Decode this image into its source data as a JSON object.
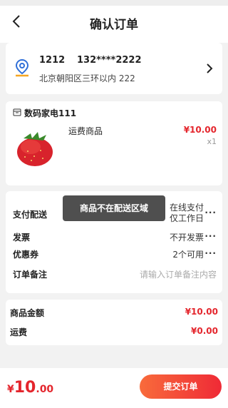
{
  "header": {
    "title": "确认订单",
    "back_icon": "chevron-left-icon"
  },
  "address": {
    "name": "1212",
    "phone": "132****2222",
    "detail": "北京朝阳区三环以内 222",
    "pin_icon": "location-pin-icon",
    "accent_color": "#2f6fd8",
    "arrow_icon": "chevron-right-icon"
  },
  "store": {
    "shop_icon": "shop-icon",
    "name": "数码家电111",
    "goods": [
      {
        "name": "运费商品",
        "price": "¥10.00",
        "qty": "x1",
        "image": "strawberry"
      }
    ]
  },
  "options": {
    "pay_label": "支付配送",
    "pay_value_line1": "在线支付",
    "pay_value_line2": "仅工作日",
    "invoice_label": "发票",
    "invoice_value": "不开发票",
    "coupon_label": "优惠券",
    "coupon_value": "2个可用",
    "remark_label": "订单备注",
    "remark_placeholder": "请输入订单备注内容",
    "more_icon": "more-dots-icon",
    "more_text": "···"
  },
  "toast": {
    "text": "商品不在配送区域"
  },
  "summary": {
    "goods_amount_label": "商品金额",
    "goods_amount": "¥10.00",
    "freight_label": "运费",
    "freight": "¥0.00"
  },
  "footer": {
    "total_symbol": "¥",
    "total_int": "10",
    "total_dec": ".00",
    "submit_label": "提交订单",
    "price_color": "#e4262d"
  }
}
